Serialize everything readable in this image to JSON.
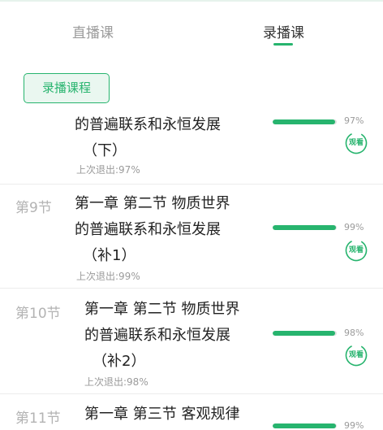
{
  "tabs": [
    {
      "label": "直播课",
      "active": false
    },
    {
      "label": "录播课",
      "active": true
    }
  ],
  "badge": "录播课程",
  "watch_label": "观看",
  "accent": "#27b46e",
  "items": [
    {
      "index": "",
      "title_lines": [
        "的普遍联系和永恒发展",
        "（下）"
      ],
      "last_exit": "上次退出:97%",
      "progress": 97,
      "percent_label": "97%"
    },
    {
      "index": "第9节",
      "title_lines": [
        "第一章 第二节 物质世界",
        "的普遍联系和永恒发展",
        "（补1）"
      ],
      "last_exit": "上次退出:99%",
      "progress": 99,
      "percent_label": "99%"
    },
    {
      "index": "第10节",
      "title_lines": [
        "第一章 第二节 物质世界",
        "的普遍联系和永恒发展",
        "（补2）"
      ],
      "last_exit": "上次退出:98%",
      "progress": 98,
      "percent_label": "98%"
    },
    {
      "index": "第11节",
      "title_lines": [
        "第一章 第三节 客观规律"
      ],
      "last_exit": "",
      "progress": 99,
      "percent_label": "99%"
    }
  ]
}
